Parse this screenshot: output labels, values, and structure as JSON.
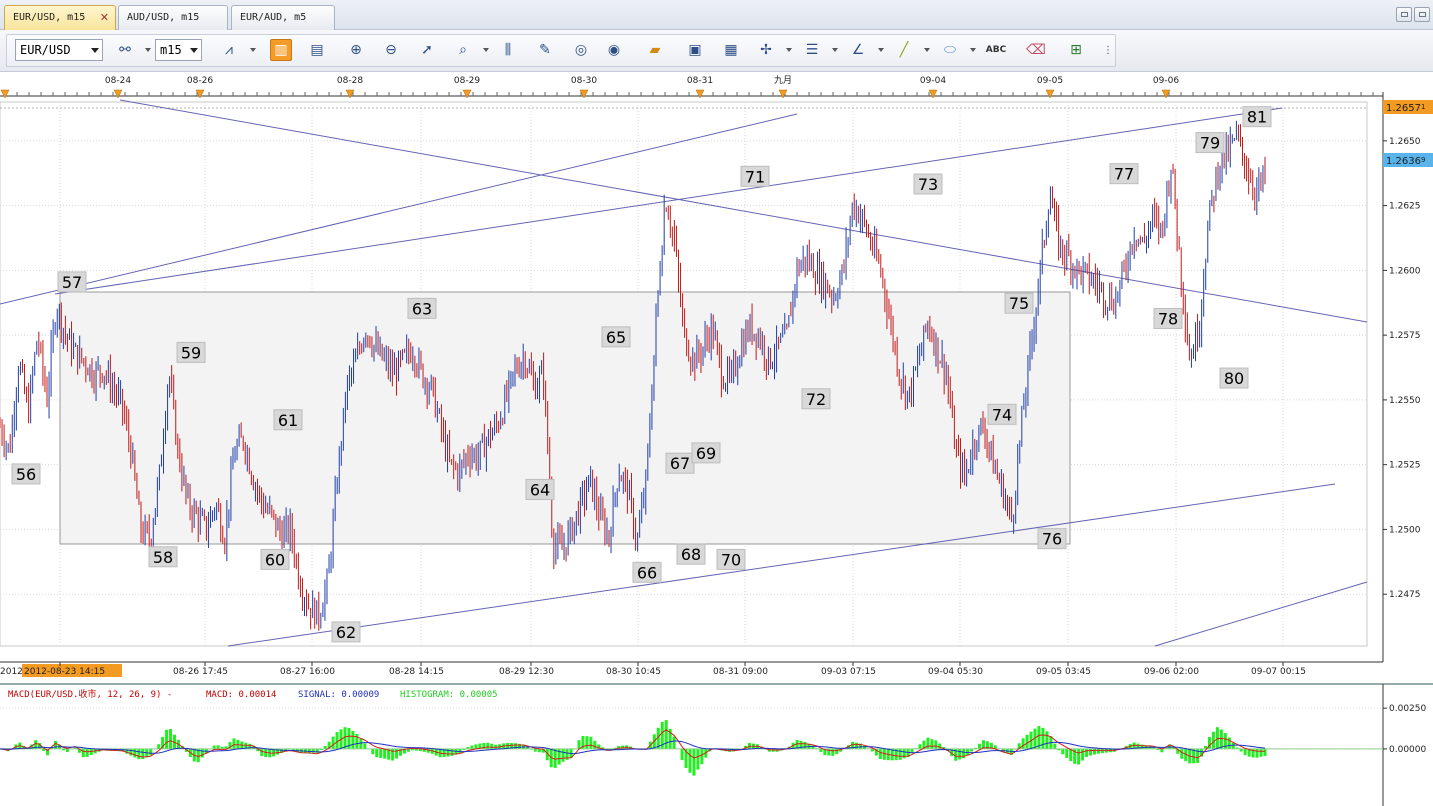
{
  "tabs": [
    {
      "label": "EUR/USD, m15",
      "active": true
    },
    {
      "label": "AUD/USD, m15",
      "active": false
    },
    {
      "label": "EUR/AUD, m5",
      "active": false
    }
  ],
  "toolbar": {
    "symbol": "EUR/USD",
    "timeframe": "m15",
    "icons": [
      "link-icon",
      "chart-type-icon",
      "candle-mode-icon",
      "bar-mode-icon",
      "zoom-in-icon",
      "zoom-out-icon",
      "cursor-icon",
      "zoom-icon",
      "period-separator-icon",
      "draw-icon",
      "eye-icon",
      "globe-icon",
      "ruler-icon",
      "screenshot-icon",
      "template-icon",
      "crosshair-icon",
      "horizontal-lines-icon",
      "trendline-icon",
      "pencil-icon",
      "ellipse-icon",
      "text-label-icon",
      "eraser-icon",
      "object-tree-icon",
      "more-icon"
    ],
    "text_icon_label": "ABC"
  },
  "chart_data": {
    "type": "line",
    "symbol": "EUR/USD",
    "timeframe": "m15",
    "top_dates": [
      "08-24",
      "08-26",
      "08-28",
      "08-29",
      "08-30",
      "08-31",
      "九月",
      "09-04",
      "09-05",
      "09-06"
    ],
    "time_labels": [
      "2012-08-23 14:15",
      "08-26 17:45",
      "08-27 16:00",
      "08-28 14:15",
      "08-29 12:30",
      "08-30 10:45",
      "08-31 09:00",
      "09-03 07:15",
      "09-04 05:30",
      "09-05 03:45",
      "09-06 02:00",
      "09-07 00:15"
    ],
    "highlighted_time": "2012-08-23 14:15",
    "price_ticks": [
      "1.2650",
      "1.2625",
      "1.2600",
      "1.2575",
      "1.2550",
      "1.2525",
      "1.2500",
      "1.2475"
    ],
    "price_badges": {
      "top": "1.2657",
      "top_suffix": "1",
      "current": "1.2636",
      "current_suffix": "9"
    },
    "ylim": [
      1.2455,
      1.2665
    ],
    "wave_labels": [
      {
        "label": "56",
        "price": 1.2528
      },
      {
        "label": "57",
        "price": 1.2589
      },
      {
        "label": "58",
        "price": 1.2496
      },
      {
        "label": "59",
        "price": 1.2561
      },
      {
        "label": "60",
        "price": 1.2495
      },
      {
        "label": "61",
        "price": 1.2535
      },
      {
        "label": "62",
        "price": 1.2467
      },
      {
        "label": "63",
        "price": 1.2578
      },
      {
        "label": "64",
        "price": 1.2522
      },
      {
        "label": "65",
        "price": 1.2567
      },
      {
        "label": "66",
        "price": 1.249
      },
      {
        "label": "67",
        "price": 1.2519
      },
      {
        "label": "68",
        "price": 1.2497
      },
      {
        "label": "69",
        "price": 1.2523
      },
      {
        "label": "70",
        "price": 1.2495
      },
      {
        "label": "71",
        "price": 1.2629
      },
      {
        "label": "72",
        "price": 1.2557
      },
      {
        "label": "73",
        "price": 1.2626
      },
      {
        "label": "74",
        "price": 1.2551
      },
      {
        "label": "75",
        "price": 1.258
      },
      {
        "label": "76",
        "price": 1.2503
      },
      {
        "label": "77",
        "price": 1.263
      },
      {
        "label": "78",
        "price": 1.2588
      },
      {
        "label": "79",
        "price": 1.2642
      },
      {
        "label": "80",
        "price": 1.2565
      },
      {
        "label": "81",
        "price": 1.2652
      }
    ],
    "price_path": [
      1.254,
      1.253,
      1.2565,
      1.2545,
      1.2575,
      1.255,
      1.2587,
      1.2575,
      1.2568,
      1.2565,
      1.256,
      1.2562,
      1.2555,
      1.2548,
      1.253,
      1.25,
      1.2496,
      1.252,
      1.2561,
      1.253,
      1.251,
      1.2505,
      1.25,
      1.251,
      1.2497,
      1.253,
      1.2535,
      1.252,
      1.251,
      1.2505,
      1.2498,
      1.25,
      1.248,
      1.247,
      1.2467,
      1.248,
      1.252,
      1.2555,
      1.2565,
      1.2578,
      1.257,
      1.2565,
      1.256,
      1.2565,
      1.257,
      1.256,
      1.2555,
      1.254,
      1.2525,
      1.2522,
      1.253,
      1.2528,
      1.2535,
      1.254,
      1.255,
      1.2562,
      1.2567,
      1.2555,
      1.256,
      1.2495,
      1.2492,
      1.25,
      1.251,
      1.2519,
      1.2505,
      1.2497,
      1.2523,
      1.2515,
      1.2495,
      1.252,
      1.258,
      1.2629,
      1.261,
      1.2575,
      1.2565,
      1.257,
      1.2578,
      1.256,
      1.2557,
      1.257,
      1.2578,
      1.2575,
      1.2565,
      1.257,
      1.2575,
      1.26,
      1.2605,
      1.26,
      1.2595,
      1.259,
      1.26,
      1.2626,
      1.262,
      1.261,
      1.26,
      1.258,
      1.256,
      1.2551,
      1.2565,
      1.258,
      1.257,
      1.256,
      1.253,
      1.252,
      1.2535,
      1.254,
      1.2525,
      1.2515,
      1.2503,
      1.254,
      1.257,
      1.26,
      1.263,
      1.261,
      1.2605,
      1.26,
      1.2598,
      1.2595,
      1.259,
      1.2588,
      1.26,
      1.2615,
      1.261,
      1.262,
      1.2615,
      1.2642,
      1.26,
      1.2565,
      1.258,
      1.262,
      1.264,
      1.2645,
      1.2652,
      1.264,
      1.263,
      1.2636
    ],
    "indicator": {
      "title": "MACD(EUR/USD.收市, 12, 26, 9) -",
      "macd_label": "MACD: 0.00014",
      "signal_label": "SIGNAL: 0.00009",
      "histogram_label": "HISTOGRAM: 0.00005",
      "ticks": [
        "0.00250",
        "0.00000"
      ],
      "ylim": [
        -0.0035,
        0.003
      ]
    },
    "colors": {
      "bull": "#1f3ea8",
      "bear": "#c21818",
      "trendline": "#4a4aa8",
      "box_fill": "#f3f3f3",
      "badge_top": "#f29a22",
      "badge_current": "#58b4ea",
      "macd": "#d51d1d",
      "signal": "#2030c0",
      "histogram": "#22ee22"
    }
  }
}
